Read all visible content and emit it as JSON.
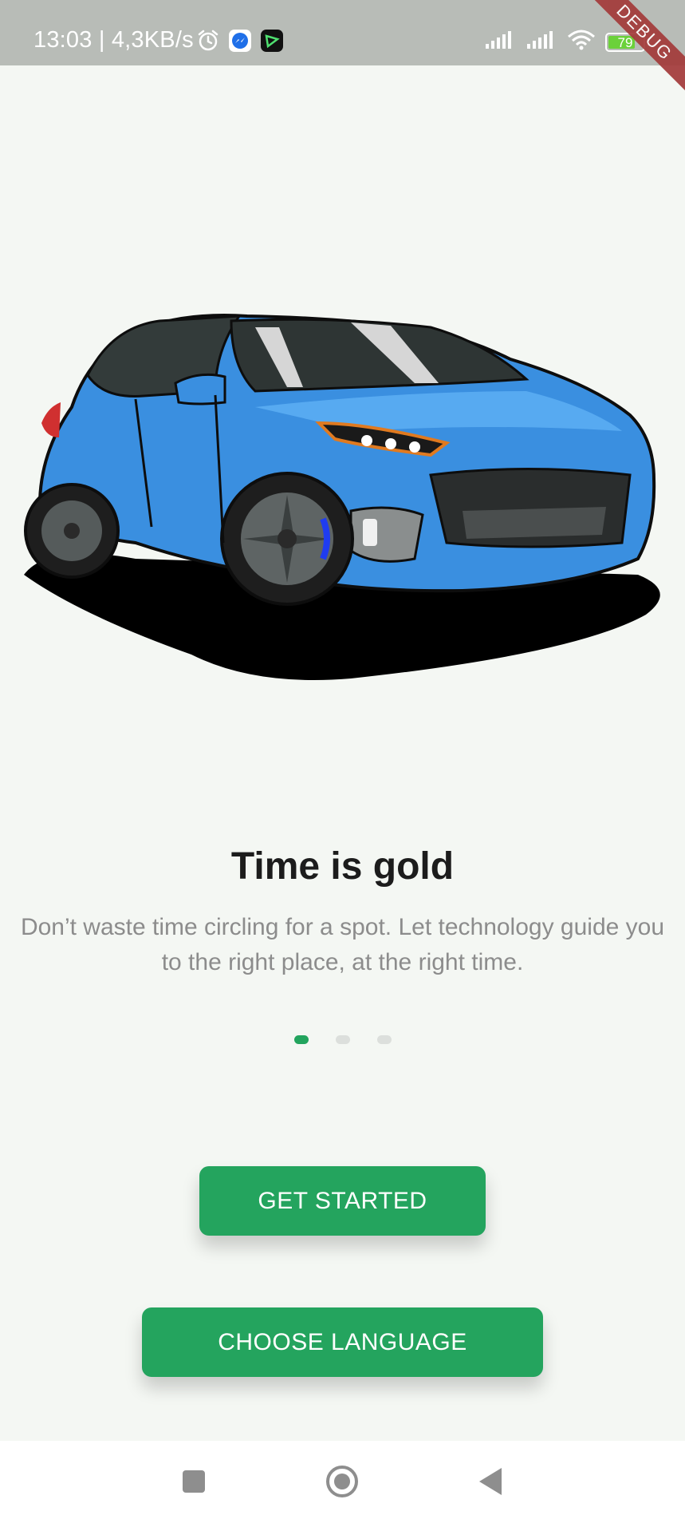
{
  "status_bar": {
    "time_speed": "13:03 | 4,3KB/s",
    "battery_level": "79",
    "icons": [
      "alarm-icon",
      "messenger-icon",
      "app-notification-icon",
      "signal-icon",
      "signal-icon",
      "wifi-icon",
      "battery-icon"
    ]
  },
  "debug_banner": "DEBUG",
  "onboarding": {
    "illustration": "blue-hatchback-car",
    "title": "Time is gold",
    "description": "Don’t waste time circling for a spot. Let technology guide you to the right place, at the right time.",
    "page_count": 3,
    "active_page": 0
  },
  "buttons": {
    "get_started": "GET STARTED",
    "choose_language": "CHOOSE LANGUAGE"
  },
  "nav_bar": {
    "items": [
      "recent-apps-icon",
      "home-icon",
      "back-icon"
    ]
  },
  "colors": {
    "accent": "#24a45e",
    "background": "#f4f7f3",
    "car_body": "#3a8fe0"
  }
}
